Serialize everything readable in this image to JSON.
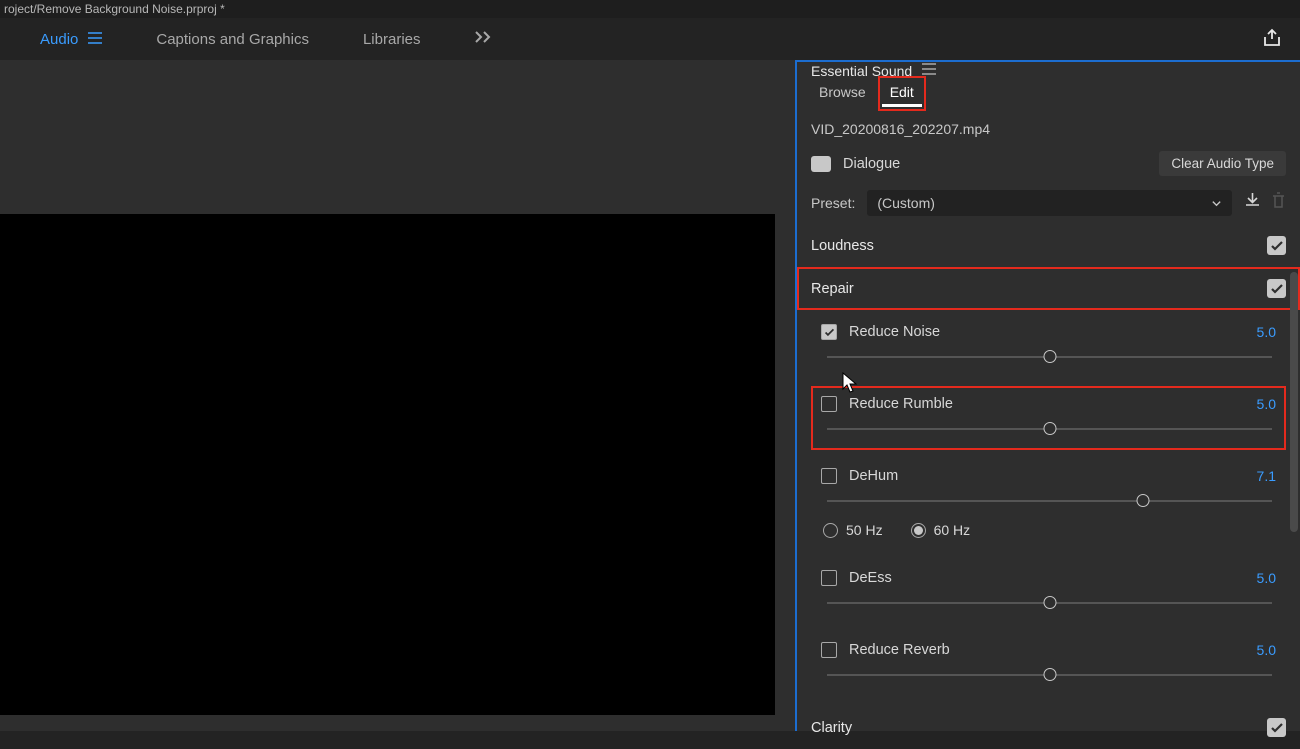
{
  "titlebar": "roject/Remove Background Noise.prproj *",
  "workspace": {
    "tabs": [
      "Audio",
      "Captions and Graphics",
      "Libraries"
    ],
    "active_index": 0
  },
  "panel": {
    "title": "Essential Sound",
    "tabs": {
      "browse": "Browse",
      "edit": "Edit"
    },
    "clip_name": "VID_20200816_202207.mp4",
    "audio_type": {
      "label": "Dialogue",
      "clear": "Clear Audio Type"
    },
    "preset": {
      "label": "Preset:",
      "value": "(Custom)"
    },
    "sections": {
      "loudness": {
        "title": "Loudness",
        "enabled": true
      },
      "repair": {
        "title": "Repair",
        "enabled": true,
        "controls": {
          "reduce_noise": {
            "label": "Reduce Noise",
            "checked": true,
            "value": "5.0",
            "pos": 50
          },
          "reduce_rumble": {
            "label": "Reduce Rumble",
            "checked": false,
            "value": "5.0",
            "pos": 50
          },
          "dehum": {
            "label": "DeHum",
            "checked": false,
            "value": "7.1",
            "pos": 71,
            "freq": {
              "hz50": "50 Hz",
              "hz60": "60 Hz",
              "selected": "60"
            }
          },
          "deess": {
            "label": "DeEss",
            "checked": false,
            "value": "5.0",
            "pos": 50
          },
          "reduce_reverb": {
            "label": "Reduce Reverb",
            "checked": false,
            "value": "5.0",
            "pos": 50
          }
        }
      },
      "clarity": {
        "title": "Clarity",
        "enabled": true
      }
    }
  }
}
